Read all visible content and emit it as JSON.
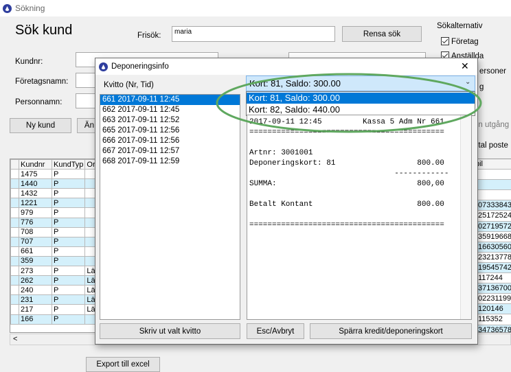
{
  "window": {
    "title": "Sökning"
  },
  "search": {
    "heading": "Sök kund",
    "fritext_label": "Frisök:",
    "fritext_value": "maria",
    "clear_button": "Rensa sök",
    "kundnr_label": "Kundnr:",
    "foretagsnamn_label": "Företagsnamn:",
    "personnamn_label": "Personnamn:",
    "new_customer_button": "Ny kund",
    "partial_button": "Än",
    "export_button": "Export till excel"
  },
  "options": {
    "title": "Sökalternativ",
    "items": [
      "Företag",
      "Anställda",
      "ersoner",
      "g"
    ],
    "partial_text_1": "en utgång",
    "partial_text_2": "ntal poste"
  },
  "grid": {
    "columns": [
      "Kundnr",
      "KundTyp",
      "Or"
    ],
    "rows": [
      {
        "kundnr": "1475",
        "typ": "P",
        "or": "",
        "right": "",
        "hl": false
      },
      {
        "kundnr": "1440",
        "typ": "P",
        "or": "",
        "right": "",
        "hl": true
      },
      {
        "kundnr": "1432",
        "typ": "P",
        "or": "",
        "right": "",
        "hl": false
      },
      {
        "kundnr": "1221",
        "typ": "P",
        "or": "",
        "right": "07333843",
        "hl": true
      },
      {
        "kundnr": "979",
        "typ": "P",
        "or": "",
        "right": "25172524",
        "hl": false
      },
      {
        "kundnr": "776",
        "typ": "P",
        "or": "",
        "right": "02719572",
        "hl": true
      },
      {
        "kundnr": "708",
        "typ": "P",
        "or": "",
        "right": "35919668",
        "hl": false
      },
      {
        "kundnr": "707",
        "typ": "P",
        "or": "",
        "right": "16630560",
        "hl": true
      },
      {
        "kundnr": "661",
        "typ": "P",
        "or": "",
        "right": "23213778",
        "hl": false
      },
      {
        "kundnr": "359",
        "typ": "P",
        "or": "",
        "right": "19545742",
        "hl": true
      },
      {
        "kundnr": "273",
        "typ": "P",
        "or": "Lä",
        "right": "117244",
        "hl": false
      },
      {
        "kundnr": "262",
        "typ": "P",
        "or": "Lä",
        "right": "37136700",
        "hl": true
      },
      {
        "kundnr": "240",
        "typ": "P",
        "or": "Lä",
        "right": "02231199",
        "hl": false
      },
      {
        "kundnr": "231",
        "typ": "P",
        "or": "Lä",
        "right": "120146",
        "hl": true
      },
      {
        "kundnr": "217",
        "typ": "P",
        "or": "Lä",
        "right": "115352",
        "hl": false
      },
      {
        "kundnr": "166",
        "typ": "P",
        "or": "",
        "right": "34736578",
        "hl": true
      }
    ],
    "right_header": "bil",
    "scroll_left": "<"
  },
  "dialog": {
    "title": "Deponeringsinfo",
    "close_label": "✕",
    "kvitto_label": "Kvitto (Nr, Tid)",
    "receipts": [
      "661 2017-09-11 12:45",
      "662 2017-09-11 12:45",
      "663 2017-09-11 12:52",
      "665 2017-09-11 12:56",
      "666 2017-09-11 12:56",
      "667 2017-09-11 12:57",
      "668 2017-09-11 12:59"
    ],
    "card_select_value": "Kort: 81, Saldo: 300.00",
    "card_options": [
      "Kort: 81, Saldo: 300.00",
      "Kort: 82, Saldo: 440.00"
    ],
    "receipt_lines": [
      "2017-09-11 12:45         Kassa 5 Adm Nr 661",
      "===========================================",
      "",
      "Artnr: 3001001",
      "Deponeringskort: 81                  800.00",
      "                                ------------",
      "SUMMA:                               800,00",
      "",
      "Betalt Kontant                       800.00",
      "",
      "==========================================="
    ],
    "print_button": "Skriv ut valt kvitto",
    "cancel_button": "Esc/Avbryt",
    "block_button": "Spärra kredit/deponeringskort"
  },
  "colors": {
    "selection": "#0078d7",
    "annotation": "#5fa85f",
    "row_highlight": "#d4f0fb"
  }
}
